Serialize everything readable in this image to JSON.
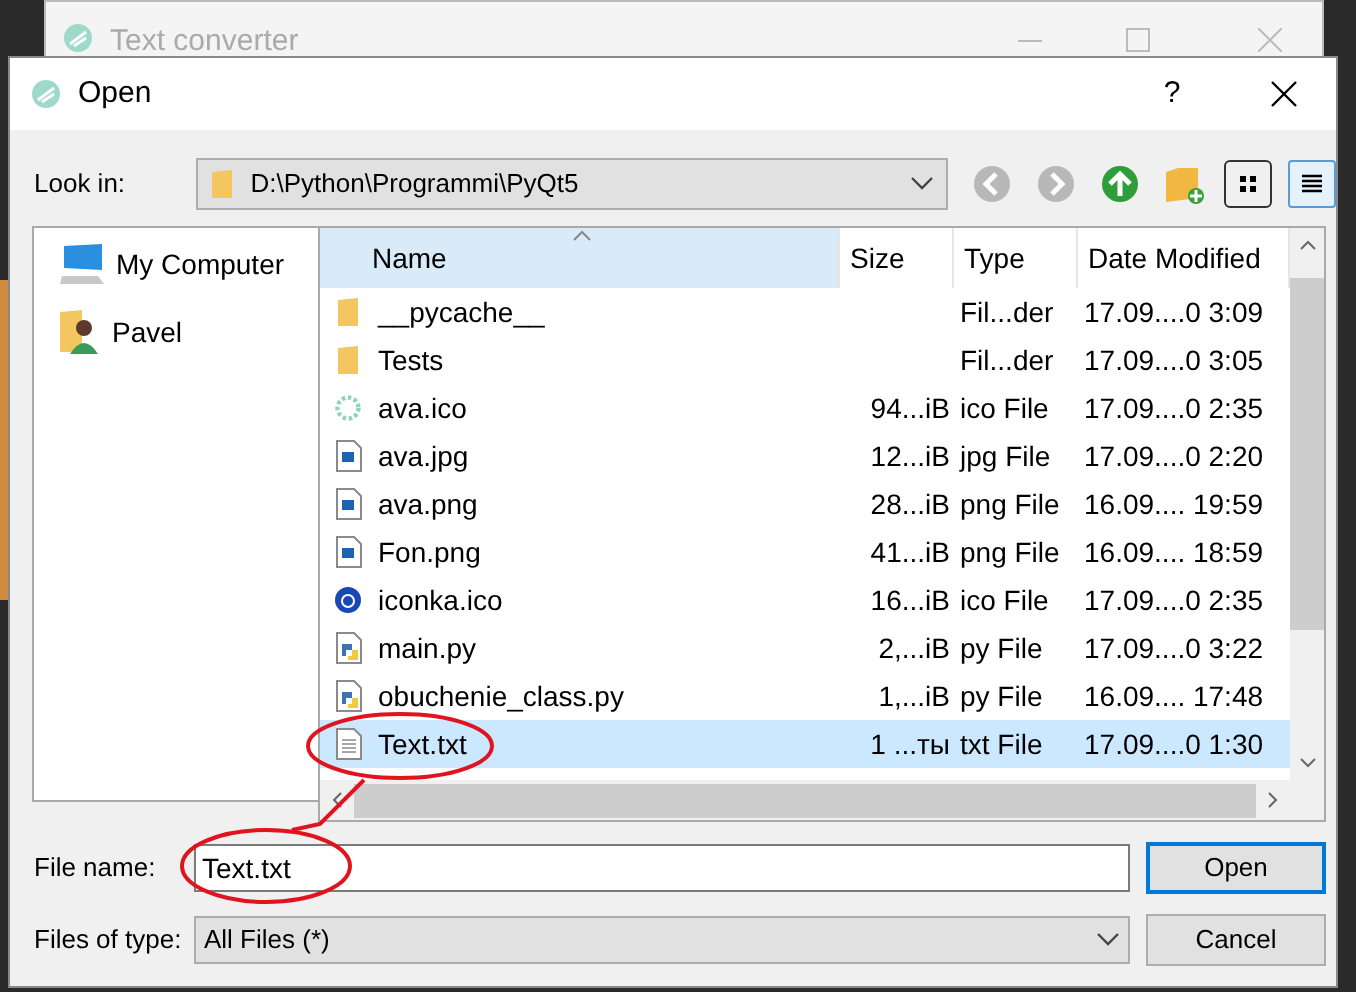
{
  "background_window": {
    "title": "Text converter"
  },
  "dialog": {
    "title": "Open",
    "help": "?"
  },
  "look_in": {
    "label": "Look in:",
    "path": "D:\\Python\\Programmi\\PyQt5"
  },
  "toolbar": [
    {
      "kind": "back",
      "selected": false
    },
    {
      "kind": "forward",
      "selected": false
    },
    {
      "kind": "up",
      "selected": false
    },
    {
      "kind": "new-folder",
      "selected": false
    },
    {
      "kind": "list-view",
      "selected": false
    },
    {
      "kind": "detail-view",
      "selected": true
    }
  ],
  "sidebar": {
    "items": [
      {
        "kind": "computer",
        "label": "My Computer"
      },
      {
        "kind": "user",
        "label": "Pavel"
      }
    ]
  },
  "table": {
    "columns": [
      "Name",
      "Size",
      "Type",
      "Date Modified"
    ],
    "rows": [
      {
        "kind": "folder",
        "name": "__pycache__",
        "size": "",
        "type": "Fil...der",
        "date": "17.09....0 3:09",
        "selected": false
      },
      {
        "kind": "folder",
        "name": "Tests",
        "size": "",
        "type": "Fil...der",
        "date": "17.09....0 3:05",
        "selected": false
      },
      {
        "kind": "ring",
        "name": "ava.ico",
        "size": "94...iB",
        "type": "ico File",
        "date": "17.09....0 2:35",
        "selected": false
      },
      {
        "kind": "image",
        "name": "ava.jpg",
        "size": "12...iB",
        "type": "jpg File",
        "date": "17.09....0 2:20",
        "selected": false
      },
      {
        "kind": "image",
        "name": "ava.png",
        "size": "28...iB",
        "type": "png File",
        "date": "16.09.... 19:59",
        "selected": false
      },
      {
        "kind": "image",
        "name": "Fon.png",
        "size": "41...iB",
        "type": "png File",
        "date": "16.09.... 18:59",
        "selected": false
      },
      {
        "kind": "round",
        "name": "iconka.ico",
        "size": "16...iB",
        "type": "ico File",
        "date": "17.09....0 2:35",
        "selected": false
      },
      {
        "kind": "python",
        "name": "main.py",
        "size": "2,...iB",
        "type": "py File",
        "date": "17.09....0 3:22",
        "selected": false
      },
      {
        "kind": "python",
        "name": "obuchenie_class.py",
        "size": "1,...iB",
        "type": "py File",
        "date": "16.09.... 17:48",
        "selected": false
      },
      {
        "kind": "text",
        "name": "Text.txt",
        "size": "1 ...ты",
        "type": "txt File",
        "date": "17.09....0 1:30",
        "selected": true
      }
    ]
  },
  "file_name": {
    "label": "File name:",
    "value": "Text.txt"
  },
  "file_type": {
    "label": "Files of type:",
    "value": "All Files (*)"
  },
  "buttons": [
    {
      "label": "Open",
      "kind": "default"
    },
    {
      "label": "Cancel",
      "kind": "normal"
    }
  ]
}
